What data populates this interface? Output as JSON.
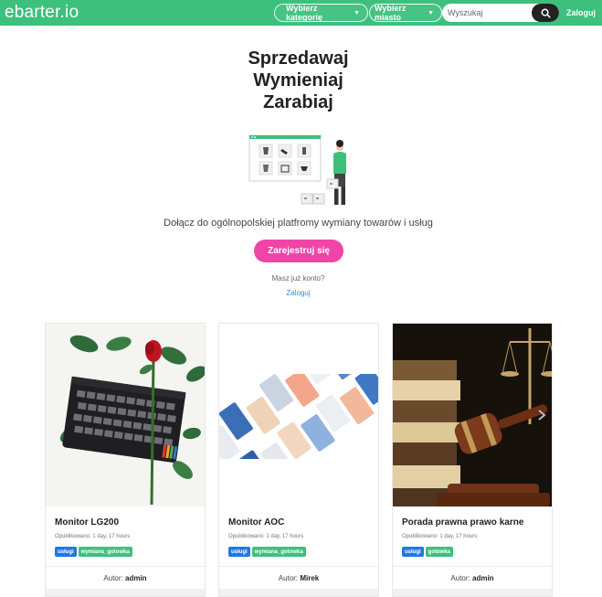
{
  "header": {
    "logo": "ebarter.io",
    "category_label": "Wybierz kategorię",
    "city_label": "Wybierz miasto",
    "search_placeholder": "Wyszukaj",
    "login_label": "Zaloguj",
    "colors": {
      "brand": "#3ec07d",
      "search_button": "#222222"
    }
  },
  "hero": {
    "title_lines": [
      "Sprzedawaj",
      "Wymieniaj",
      "Zarabiaj"
    ],
    "subtitle": "Dołącz do ogólnopolskiej platfromy wymiany towarów i usług",
    "register_label": "Zarejestruj się",
    "have_account": "Masz już konto?",
    "login_label": "Zaloguj",
    "colors": {
      "register_button": "#f044a8",
      "link": "#2f8fd8"
    }
  },
  "listings": [
    {
      "title": "Monitor LG200",
      "published": "Opublikowano: 1 day, 17 hours",
      "tags": [
        "usługi",
        "wymiana_gotowka"
      ],
      "author_label": "Autor:",
      "author": "admin"
    },
    {
      "title": "Monitor AOC",
      "published": "Opublikowano: 1 day, 17 hours",
      "tags": [
        "usługi",
        "wymiana_gotowka"
      ],
      "author_label": "Autor:",
      "author": "Mirek"
    },
    {
      "title": "Porada prawna prawo karne",
      "published": "Opublikowano: 1 day, 17 hours",
      "tags": [
        "usługi",
        "gotowka"
      ],
      "author_label": "Autor:",
      "author": "admin"
    }
  ]
}
